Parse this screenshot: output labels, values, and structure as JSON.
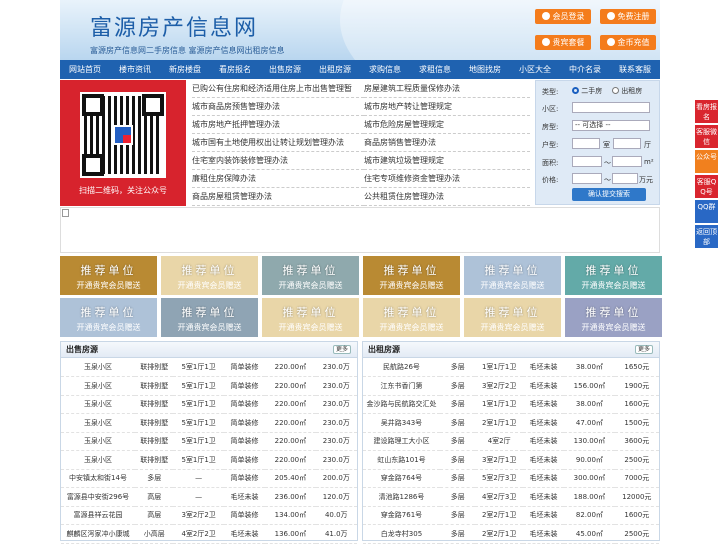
{
  "header": {
    "title": "富源房产信息网",
    "subtitle": "富源房产信息网二手房信息   富源房产信息网出租房信息",
    "buttons": [
      {
        "label": "会员登录"
      },
      {
        "label": "免费注册"
      },
      {
        "label": "贵宾套餐"
      },
      {
        "label": "金币充值"
      }
    ]
  },
  "nav": [
    "网站首页",
    "楼市资讯",
    "新房楼盘",
    "看房报名",
    "出售房源",
    "出租房源",
    "求购信息",
    "求租信息",
    "地图找房",
    "小区大全",
    "中介名录",
    "联系客服"
  ],
  "qr": {
    "caption": "扫描二维码，关注公众号"
  },
  "links_left": [
    "已购公有住房和经济适用住房上市出售管理暂",
    "城市商品房预售管理办法",
    "城市房地产抵押管理办法",
    "城市国有土地使用权出让转让规划管理办法",
    "住宅室内装饰装修管理办法",
    "廉租住房保障办法",
    "商品房屋租赁管理办法"
  ],
  "links_right": [
    "房屋建筑工程质量保修办法",
    "城市房地产转让管理规定",
    "城市危险房屋管理规定",
    "商品房销售管理办法",
    "城市建筑垃圾管理规定",
    "住宅专项维修资金管理办法",
    "公共租赁住房管理办法"
  ],
  "search": {
    "type_label": "类型:",
    "opt_sale": "二手房",
    "opt_rent": "出租房",
    "community_label": "小区:",
    "house_type_label": "房型:",
    "select_placeholder": "-- 可选择 --",
    "layout_label": "户型:",
    "room_unit": "室",
    "hall_unit": "厅",
    "area_label": "面积:",
    "area_unit": "m²",
    "price_label": "价格:",
    "price_unit": "万元",
    "submit": "确认提交搜索"
  },
  "ads": {
    "t1": "推荐单位",
    "t2": "开通贵宾会员赠送",
    "colors": [
      "#b98a33",
      "#e9d6a8",
      "#8fa9ad",
      "#b98a33",
      "#aec2d8",
      "#63aaa8",
      "#aec2d8",
      "#8fa4b4",
      "#e9d6a8",
      "#e9d6a8",
      "#e9d6a8",
      "#9aa1c4"
    ]
  },
  "sale": {
    "title": "出售房源",
    "more": "更多",
    "rows": [
      [
        "玉泉小区",
        "联排别墅",
        "5室1厅1卫",
        "简单装修",
        "220.00㎡",
        "230.0万"
      ],
      [
        "玉泉小区",
        "联排别墅",
        "5室1厅1卫",
        "简单装修",
        "220.00㎡",
        "230.0万"
      ],
      [
        "玉泉小区",
        "联排别墅",
        "5室1厅1卫",
        "简单装修",
        "220.00㎡",
        "230.0万"
      ],
      [
        "玉泉小区",
        "联排别墅",
        "5室1厅1卫",
        "简单装修",
        "220.00㎡",
        "230.0万"
      ],
      [
        "玉泉小区",
        "联排别墅",
        "5室1厅1卫",
        "简单装修",
        "220.00㎡",
        "230.0万"
      ],
      [
        "玉泉小区",
        "联排别墅",
        "5室1厅1卫",
        "简单装修",
        "220.00㎡",
        "230.0万"
      ],
      [
        "中安镇太和街14号",
        "多层",
        "—",
        "简单装修",
        "205.40㎡",
        "200.0万"
      ],
      [
        "富源县中安街296号",
        "高层",
        "—",
        "毛坯未装",
        "236.00㎡",
        "120.0万"
      ],
      [
        "富源县祥云花园",
        "高层",
        "3室2厅2卫",
        "简单装修",
        "134.00㎡",
        "40.0万"
      ],
      [
        "麒麟区泻家冲小康城",
        "小高层",
        "4室2厅2卫",
        "毛坯未装",
        "136.00㎡",
        "41.0万"
      ]
    ]
  },
  "rent": {
    "title": "出租房源",
    "more": "更多",
    "rows": [
      [
        "民航路26号",
        "多层",
        "1室1厅1卫",
        "毛坯未装",
        "38.00㎡",
        "1650元"
      ],
      [
        "江东书香门第",
        "多层",
        "3室2厅2卫",
        "毛坯未装",
        "156.00㎡",
        "1900元"
      ],
      [
        "金沙路与民航路交汇处",
        "多层",
        "1室1厅1卫",
        "毛坯未装",
        "38.00㎡",
        "1600元"
      ],
      [
        "吴井路343号",
        "多层",
        "2室1厅1卫",
        "毛坯未装",
        "47.00㎡",
        "1500元"
      ],
      [
        "建设路理工大小区",
        "多层",
        "4室2厅",
        "毛坯未装",
        "130.00㎡",
        "3600元"
      ],
      [
        "虹山东路101号",
        "多层",
        "3室2厅1卫",
        "毛坯未装",
        "90.00㎡",
        "2500元"
      ],
      [
        "穿金路764号",
        "多层",
        "5室2厅3卫",
        "毛坯未装",
        "300.00㎡",
        "7000元"
      ],
      [
        "清池路1286号",
        "多层",
        "4室2厅3卫",
        "毛坯未装",
        "188.00㎡",
        "12000元"
      ],
      [
        "穿金路761号",
        "多层",
        "2室2厅1卫",
        "毛坯未装",
        "82.00㎡",
        "1600元"
      ],
      [
        "白龙寺村305",
        "多层",
        "2室2厅1卫",
        "毛坯未装",
        "45.00㎡",
        "2500元"
      ]
    ]
  },
  "side": [
    {
      "label": "看房报名",
      "color": "#d9252e"
    },
    {
      "label": "客服微信",
      "color": "#d9252e"
    },
    {
      "label": "公众号",
      "color": "#f1801e"
    },
    {
      "label": "客服QQ号",
      "color": "#d9252e"
    },
    {
      "label": "QQ群",
      "color": "#2968c5"
    },
    {
      "label": "返回顶部",
      "color": "#2968c5"
    }
  ]
}
